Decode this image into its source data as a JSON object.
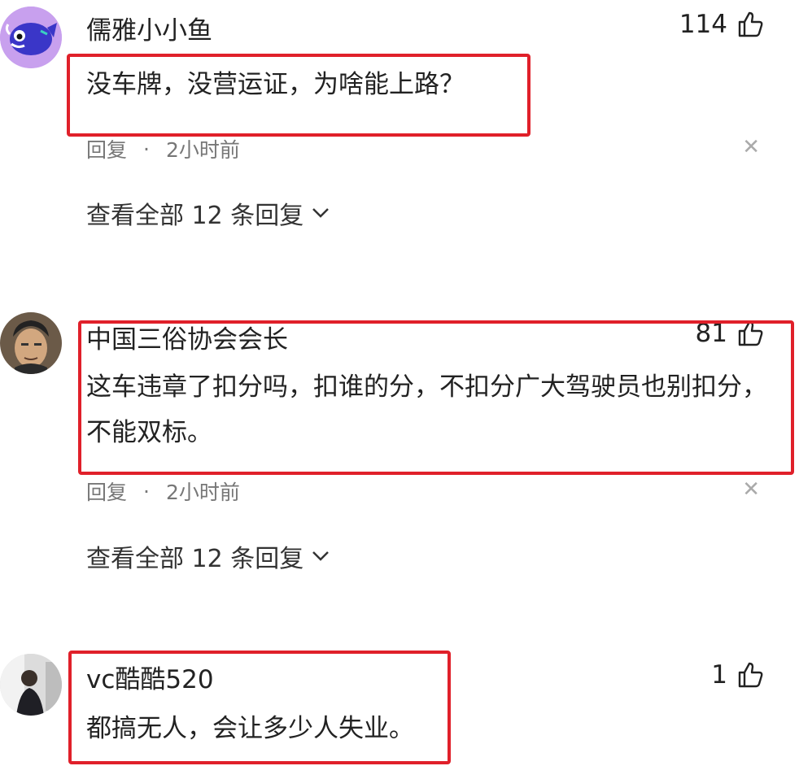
{
  "comments": [
    {
      "username": "儒雅小小鱼",
      "likes": "114",
      "text": "没车牌，没营运证，为啥能上路？",
      "reply_label": "回复",
      "dot": "·",
      "time": "2小时前",
      "view_all": "查看全部 12 条回复",
      "avatar_icon": "fish-avatar-icon",
      "avatar_color": "#b98be6"
    },
    {
      "username": "中国三俗协会会长",
      "likes": "81",
      "text": "这车违章了扣分吗，扣谁的分，不扣分广大驾驶员也别扣分，不能双标。",
      "reply_label": "回复",
      "dot": "·",
      "time": "2小时前",
      "view_all": "查看全部 12 条回复",
      "avatar_icon": "man-portrait-avatar-icon"
    },
    {
      "username": "vc酷酷520",
      "likes": "1",
      "text": "都搞无人，会让多少人失业。",
      "avatar_icon": "person-photo-avatar-icon"
    }
  ],
  "colors": {
    "highlight_border": "#e0202a",
    "meta_text": "#777777"
  }
}
